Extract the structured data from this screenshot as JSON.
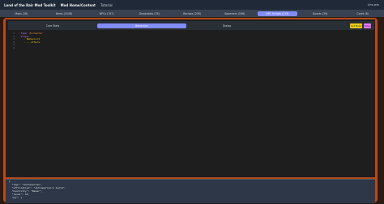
{
  "header": {
    "brand": "Land of the Rair Mod Toolkit",
    "menu": [
      {
        "label": "Mod Home/Content",
        "strong": true
      },
      {
        "label": "Tutorial",
        "strong": false
      }
    ],
    "user": "Linx.win"
  },
  "main_tabs": [
    {
      "label": "Maps (16)",
      "active": false
    },
    {
      "label": "Items (1048)",
      "active": false
    },
    {
      "label": "NPCs (797)",
      "active": false
    },
    {
      "label": "Droptables (78)",
      "active": false
    },
    {
      "label": "Recipes (208)",
      "active": false
    },
    {
      "label": "Spawners (166)",
      "active": false
    },
    {
      "label": "NPC Scripts (113)",
      "active": true
    },
    {
      "label": "Quests (39)",
      "active": false
    },
    {
      "label": "Cores (8)",
      "active": false
    }
  ],
  "editor_tabs": [
    {
      "label": "Core Stats",
      "active": false
    },
    {
      "label": "Behaviors",
      "active": true
    },
    {
      "label": "Dialog",
      "active": false
    }
  ],
  "actions": {
    "ok": "Got Build",
    "close": "Close"
  },
  "editor": {
    "line_numbers": [
      "1",
      "2",
      "3",
      "4",
      "5",
      "6"
    ],
    "line1_key": "- type:",
    "line1_value": " Enchanter",
    "line2_key": "  props:",
    "line3_value": "    - Behavior1",
    "line4_value": "    - ...others",
    "line5": "",
    "line6": ""
  },
  "preview": {
    "lines": [
      "{",
      "  \"tag\": \"Antiquarian\",",
      "  \"affiliation\": \"Antiquarian's Guild\",",
      "  \"hostility\": \"Never\",",
      "  \"level\": 10,",
      "  \"hp\": {"
    ]
  },
  "colors": {
    "accent": "#818cf8",
    "frame": "#b84a18",
    "ok_button": "#facc15",
    "close_button": "#e879f9"
  }
}
